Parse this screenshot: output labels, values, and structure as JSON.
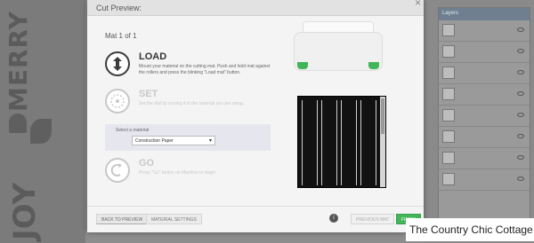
{
  "background": {
    "left_art_text_1": "MERRY",
    "left_art_text_2": "JOY",
    "layers_panel_title": "Layers",
    "watermark": "The Country Chic Cottage"
  },
  "modal": {
    "title": "Cut Preview:",
    "close_glyph": "×",
    "mat_label": "Mat  1  of  1",
    "steps": {
      "load": {
        "title": "LOAD",
        "description": "Mount your material on the cutting mat. Push and hold mat against the rollers and press the blinking \"Load mat\" button."
      },
      "set": {
        "title": "SET",
        "description": "Set the dial by turning it to the material you are using."
      },
      "go": {
        "title": "GO",
        "description": "Press \"Go\" button on Machine to begin."
      }
    },
    "material": {
      "label": "Select a material",
      "selected": "Construction Paper"
    },
    "footer": {
      "back_to_preview": "BACK TO PREVIEW",
      "material_settings": "MATERIAL SETTINGS",
      "info_glyph": "i",
      "previous_mat": "PREVIOUS MAT",
      "finish": "FINISH"
    },
    "colors": {
      "accent_green": "#43b559",
      "preview_bg": "#111111"
    }
  }
}
